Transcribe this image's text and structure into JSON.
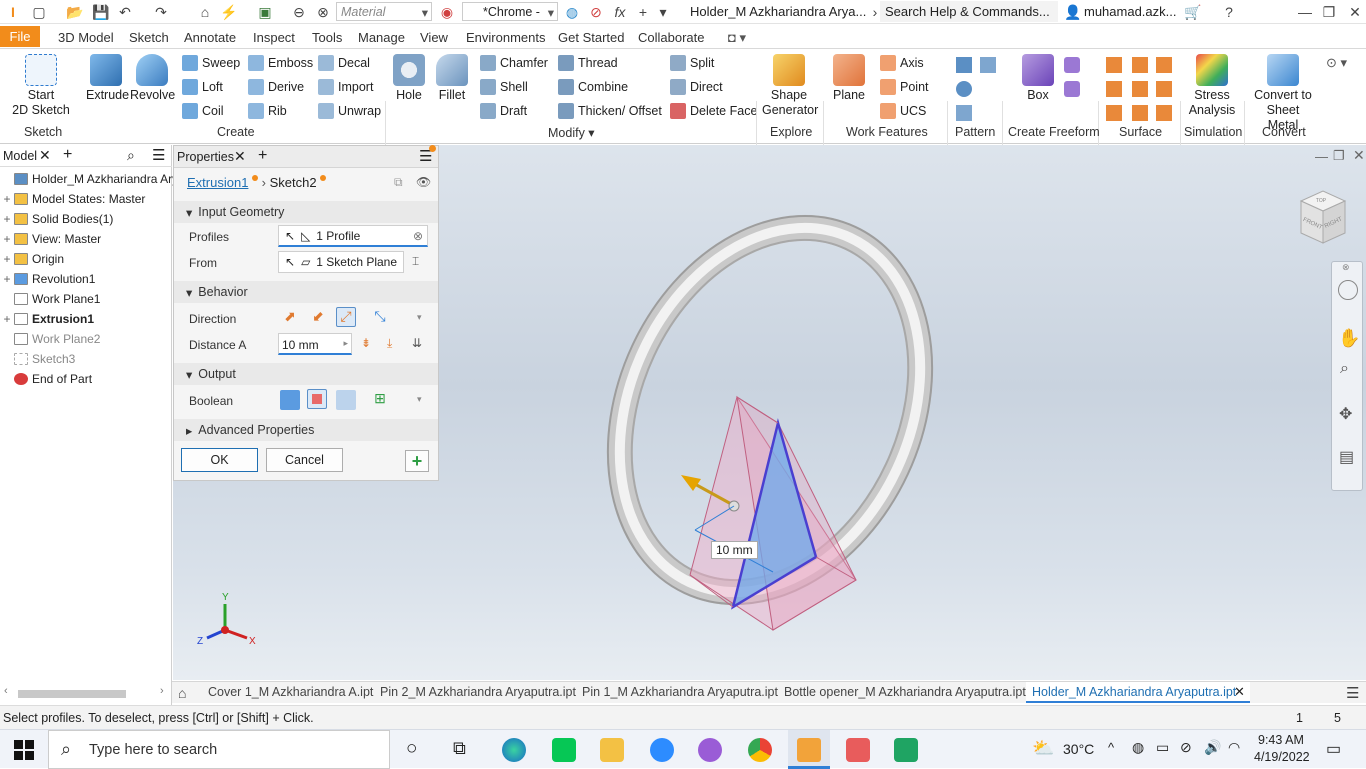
{
  "titlebar": {
    "material": "Material",
    "appearance": "*Chrome -",
    "title": "Holder_M Azkhariandra Arya...",
    "search": "Search Help & Commands...",
    "user": "muhamad.azk..."
  },
  "ribbon_tabs": [
    "File",
    "3D Model",
    "Sketch",
    "Annotate",
    "Inspect",
    "Tools",
    "Manage",
    "View",
    "Environments",
    "Get Started",
    "Collaborate"
  ],
  "ribbon": {
    "sketch": {
      "start_label": "Start\n2D Sketch",
      "group": "Sketch"
    },
    "create": {
      "extrude": "Extrude",
      "revolve": "Revolve",
      "sweep": "Sweep",
      "loft": "Loft",
      "coil": "Coil",
      "emboss": "Emboss",
      "derive": "Derive",
      "rib": "Rib",
      "decal": "Decal",
      "import": "Import",
      "unwrap": "Unwrap",
      "group": "Create"
    },
    "modify": {
      "hole": "Hole",
      "fillet": "Fillet",
      "chamfer": "Chamfer",
      "shell": "Shell",
      "draft": "Draft",
      "thread": "Thread",
      "combine": "Combine",
      "thicken": "Thicken/ Offset",
      "split": "Split",
      "direct": "Direct",
      "delete_face": "Delete Face",
      "group": "Modify"
    },
    "explore": {
      "shape_generator": "Shape\nGenerator",
      "group": "Explore"
    },
    "work": {
      "plane": "Plane",
      "axis": "Axis",
      "point": "Point",
      "ucs": "UCS",
      "group": "Work Features"
    },
    "pattern": {
      "group": "Pattern"
    },
    "freeform": {
      "box": "Box",
      "group": "Create Freeform"
    },
    "surface": {
      "group": "Surface"
    },
    "simulation": {
      "stress": "Stress\nAnalysis",
      "group": "Simulation"
    },
    "convert": {
      "sheet_metal": "Convert to\nSheet Metal",
      "group": "Convert"
    }
  },
  "browser": {
    "tab": "Model",
    "items": [
      {
        "label": "Holder_M Azkhariandra Aryaput",
        "pm": "",
        "bold": false
      },
      {
        "label": "Model States: Master",
        "pm": "+",
        "bold": false
      },
      {
        "label": "Solid Bodies(1)",
        "pm": "+",
        "bold": false
      },
      {
        "label": "View: Master",
        "pm": "+",
        "bold": false
      },
      {
        "label": "Origin",
        "pm": "+",
        "bold": false
      },
      {
        "label": "Revolution1",
        "pm": "+",
        "bold": false
      },
      {
        "label": "Work Plane1",
        "pm": "",
        "bold": false
      },
      {
        "label": "Extrusion1",
        "pm": "+",
        "bold": true
      },
      {
        "label": "Work Plane2",
        "pm": "",
        "bold": false
      },
      {
        "label": "Sketch3",
        "pm": "",
        "bold": false
      },
      {
        "label": "End of Part",
        "pm": "",
        "bold": false
      }
    ]
  },
  "properties": {
    "tab": "Properties",
    "breadcrumb": {
      "feature": "Extrusion1",
      "sketch": "Sketch2"
    },
    "input_geometry": "Input Geometry",
    "profiles_label": "Profiles",
    "profiles_value": "1 Profile",
    "from_label": "From",
    "from_value": "1 Sketch Plane",
    "behavior": "Behavior",
    "direction_label": "Direction",
    "distance_label": "Distance A",
    "distance_value": "10 mm",
    "output": "Output",
    "boolean_label": "Boolean",
    "advanced": "Advanced Properties",
    "ok": "OK",
    "cancel": "Cancel"
  },
  "viewport": {
    "dimension": "10 mm",
    "viewcube_front": "FRONT",
    "viewcube_right": "RIGHT",
    "viewcube_top": "TOP",
    "triad_x": "X",
    "triad_y": "Y",
    "triad_z": "Z"
  },
  "doc_tabs": [
    "Cover 1_M Azkhariandra A.ipt",
    "Pin 2_M Azkhariandra Aryaputra.ipt",
    "Pin 1_M Azkhariandra Aryaputra.ipt",
    "Bottle opener_M Azkhariandra Aryaputra.ipt",
    "Holder_M Azkhariandra Aryaputra.ipt"
  ],
  "status": {
    "message": "Select profiles. To deselect, press [Ctrl] or [Shift] + Click.",
    "count1": "1",
    "count2": "5"
  },
  "taskbar": {
    "search": "Type here to search",
    "temp": "30°C",
    "time": "9:43 AM",
    "date": "4/19/2022"
  }
}
